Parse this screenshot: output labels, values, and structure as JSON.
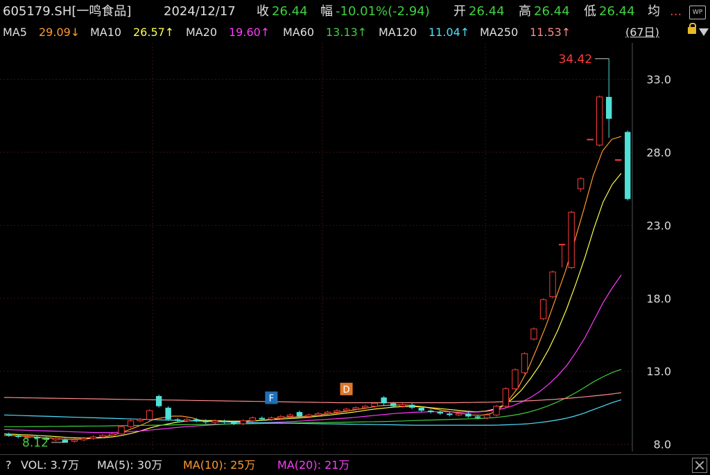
{
  "header": {
    "code": "605179.SH[一鸣食品]",
    "date": "2024/12/17",
    "close_label": "收",
    "close_value": "26.44",
    "change_label": "幅",
    "change_value": "-10.01%(-2.94)",
    "open_label": "开",
    "open_value": "26.44",
    "high_label": "高",
    "high_value": "26.44",
    "low_label": "低",
    "low_value": "26.44",
    "avg_label": "均",
    "more": "...",
    "wp_icon_text": "WP"
  },
  "ma_line": {
    "ma5": {
      "label": "MA5",
      "value": "29.09↓",
      "color": "#ff9a2e"
    },
    "ma10": {
      "label": "MA10",
      "value": "26.57↑",
      "color": "#ffff4a"
    },
    "ma20": {
      "label": "MA20",
      "value": "19.60↑",
      "color": "#ff3bff"
    },
    "ma60": {
      "label": "MA60",
      "value": "13.13↑",
      "color": "#3fcf3f"
    },
    "ma120": {
      "label": "MA120",
      "value": "11.04↑",
      "color": "#4fe0ff"
    },
    "ma250": {
      "label": "MA250",
      "value": "11.53↑",
      "color": "#ff8a8a"
    },
    "period": "(67日)"
  },
  "chart_data": {
    "type": "candlestick",
    "ylim": [
      7.5,
      35.5
    ],
    "y_ticks": [
      "33.0",
      "28.0",
      "23.0",
      "18.0",
      "13.0",
      "8.0"
    ],
    "y_tick_values": [
      33,
      28,
      23,
      18,
      13,
      8
    ],
    "annotations": {
      "max_label": "34.42",
      "max_value": 34.42,
      "min_label": "8.12",
      "min_value": 8.12,
      "flag_f": "F",
      "flag_d": "D"
    },
    "candles": [
      [
        8.7,
        8.6,
        8.8,
        8.5
      ],
      [
        8.6,
        8.5,
        8.7,
        8.4
      ],
      [
        8.5,
        8.5,
        8.6,
        8.4
      ],
      [
        8.5,
        8.4,
        8.6,
        8.3
      ],
      [
        8.4,
        8.3,
        8.5,
        8.2
      ],
      [
        8.3,
        8.4,
        8.5,
        8.2
      ],
      [
        8.3,
        8.1,
        8.4,
        8.12
      ],
      [
        8.2,
        8.3,
        8.4,
        8.1
      ],
      [
        8.3,
        8.4,
        8.5,
        8.2
      ],
      [
        8.4,
        8.5,
        8.6,
        8.3
      ],
      [
        8.5,
        8.6,
        8.7,
        8.4
      ],
      [
        8.6,
        8.7,
        8.8,
        8.5
      ],
      [
        8.7,
        9.2,
        9.3,
        8.6
      ],
      [
        9.2,
        9.6,
        9.7,
        9.1
      ],
      [
        9.6,
        9.7,
        9.8,
        9.5
      ],
      [
        9.7,
        10.3,
        10.4,
        9.6
      ],
      [
        11.3,
        10.6,
        11.4,
        10.5
      ],
      [
        10.5,
        9.7,
        10.6,
        9.6
      ],
      [
        9.7,
        9.6,
        9.8,
        9.5
      ],
      [
        9.6,
        9.7,
        9.8,
        9.5
      ],
      [
        9.7,
        9.6,
        9.8,
        9.5
      ],
      [
        9.6,
        9.5,
        9.7,
        9.4
      ],
      [
        9.5,
        9.6,
        9.7,
        9.4
      ],
      [
        9.6,
        9.5,
        9.7,
        9.4
      ],
      [
        9.5,
        9.4,
        9.6,
        9.3
      ],
      [
        9.4,
        9.6,
        9.7,
        9.3
      ],
      [
        9.6,
        9.8,
        9.9,
        9.5
      ],
      [
        9.8,
        9.7,
        9.9,
        9.6
      ],
      [
        9.7,
        9.8,
        9.9,
        9.6
      ],
      [
        9.8,
        9.9,
        10.0,
        9.7
      ],
      [
        9.9,
        10.0,
        10.1,
        9.8
      ],
      [
        10.2,
        9.9,
        10.3,
        9.8
      ],
      [
        9.9,
        10.0,
        10.1,
        9.8
      ],
      [
        10.0,
        10.1,
        10.2,
        9.9
      ],
      [
        10.1,
        10.2,
        10.3,
        10.0
      ],
      [
        10.2,
        10.3,
        10.4,
        10.1
      ],
      [
        10.3,
        10.4,
        10.5,
        10.2
      ],
      [
        10.4,
        10.5,
        10.6,
        10.3
      ],
      [
        10.5,
        10.6,
        10.7,
        10.4
      ],
      [
        10.6,
        10.8,
        10.9,
        10.5
      ],
      [
        11.2,
        10.8,
        11.3,
        10.6
      ],
      [
        10.8,
        10.6,
        10.9,
        10.5
      ],
      [
        10.6,
        10.7,
        10.8,
        10.5
      ],
      [
        10.7,
        10.5,
        10.8,
        10.4
      ],
      [
        10.5,
        10.3,
        10.6,
        10.2
      ],
      [
        10.3,
        10.2,
        10.4,
        10.1
      ],
      [
        10.2,
        10.1,
        10.3,
        10.0
      ],
      [
        10.1,
        10.0,
        10.2,
        9.9
      ],
      [
        10.0,
        10.1,
        10.2,
        9.9
      ],
      [
        10.1,
        9.9,
        10.2,
        9.8
      ],
      [
        9.9,
        9.8,
        10.0,
        9.7
      ],
      [
        9.8,
        10.0,
        10.1,
        9.7
      ],
      [
        10.0,
        10.6,
        10.7,
        9.9
      ],
      [
        10.6,
        11.8,
        11.9,
        10.5
      ],
      [
        11.8,
        13.1,
        13.2,
        11.7
      ],
      [
        12.9,
        14.2,
        14.3,
        12.8
      ],
      [
        15.2,
        15.9,
        16.0,
        15.1
      ],
      [
        16.6,
        17.9,
        18.0,
        16.5
      ],
      [
        18.1,
        19.8,
        19.9,
        18.0
      ],
      [
        21.7,
        21.7,
        21.7,
        20.1
      ],
      [
        20.1,
        23.9,
        24.0,
        20.0
      ],
      [
        25.5,
        26.2,
        26.3,
        25.3
      ],
      [
        28.9,
        28.9,
        28.9,
        28.9
      ],
      [
        28.5,
        31.8,
        31.9,
        28.4
      ],
      [
        31.8,
        30.3,
        34.42,
        29.0
      ],
      [
        27.5,
        27.5,
        27.5,
        27.5
      ],
      [
        29.4,
        24.8,
        29.5,
        24.7
      ]
    ],
    "ma_lines": {
      "ma5": [
        8.6,
        8.58,
        8.55,
        8.5,
        8.45,
        8.42,
        8.36,
        8.34,
        8.34,
        8.38,
        8.46,
        8.54,
        8.68,
        8.9,
        9.14,
        9.4,
        9.7,
        9.82,
        9.92,
        9.92,
        9.82,
        9.64,
        9.6,
        9.6,
        9.56,
        9.54,
        9.56,
        9.6,
        9.66,
        9.76,
        9.84,
        9.86,
        9.9,
        9.96,
        10.04,
        10.1,
        10.2,
        10.3,
        10.4,
        10.5,
        10.62,
        10.66,
        10.68,
        10.68,
        10.62,
        10.54,
        10.42,
        10.3,
        10.2,
        10.1,
        10.0,
        9.98,
        10.08,
        10.44,
        11.06,
        11.9,
        13.1,
        14.6,
        16.2,
        18.0,
        19.8,
        21.9,
        24.1,
        26.4,
        28.1,
        28.9,
        29.09
      ],
      "ma10": [
        8.7,
        8.68,
        8.65,
        8.62,
        8.58,
        8.55,
        8.5,
        8.46,
        8.43,
        8.42,
        8.42,
        8.44,
        8.5,
        8.6,
        8.74,
        8.9,
        9.1,
        9.26,
        9.38,
        9.5,
        9.58,
        9.62,
        9.62,
        9.62,
        9.6,
        9.58,
        9.58,
        9.6,
        9.62,
        9.66,
        9.7,
        9.74,
        9.78,
        9.82,
        9.88,
        9.94,
        10.0,
        10.08,
        10.16,
        10.24,
        10.34,
        10.42,
        10.48,
        10.54,
        10.58,
        10.58,
        10.56,
        10.5,
        10.44,
        10.38,
        10.32,
        10.26,
        10.22,
        10.26,
        10.4,
        10.66,
        11.1,
        11.7,
        12.5,
        13.4,
        14.5,
        15.8,
        17.3,
        19.0,
        20.8,
        22.8,
        24.6,
        25.8,
        26.57
      ],
      "ma20": [
        9.0,
        8.98,
        8.96,
        8.94,
        8.92,
        8.9,
        8.88,
        8.86,
        8.84,
        8.82,
        8.8,
        8.8,
        8.8,
        8.82,
        8.86,
        8.9,
        8.96,
        9.02,
        9.08,
        9.14,
        9.2,
        9.24,
        9.28,
        9.32,
        9.36,
        9.4,
        9.42,
        9.44,
        9.46,
        9.48,
        9.5,
        9.52,
        9.56,
        9.6,
        9.64,
        9.68,
        9.72,
        9.76,
        9.8,
        9.86,
        9.92,
        9.98,
        10.04,
        10.1,
        10.14,
        10.18,
        10.2,
        10.22,
        10.22,
        10.22,
        10.2,
        10.2,
        10.2,
        10.24,
        10.32,
        10.44,
        10.62,
        10.88,
        11.2,
        11.6,
        12.1,
        12.7,
        13.4,
        14.3,
        15.3,
        16.5,
        17.7,
        18.7,
        19.6
      ],
      "ma60": [
        9.2,
        9.2,
        9.2,
        9.21,
        9.21,
        9.22,
        9.22,
        9.23,
        9.23,
        9.24,
        9.24,
        9.25,
        9.26,
        9.27,
        9.28,
        9.29,
        9.3,
        9.31,
        9.32,
        9.33,
        9.34,
        9.35,
        9.36,
        9.37,
        9.38,
        9.39,
        9.4,
        9.41,
        9.42,
        9.43,
        9.44,
        9.45,
        9.46,
        9.47,
        9.48,
        9.49,
        9.5,
        9.51,
        9.52,
        9.53,
        9.54,
        9.56,
        9.58,
        9.6,
        9.62,
        9.64,
        9.66,
        9.68,
        9.7,
        9.72,
        9.74,
        9.76,
        9.8,
        9.86,
        9.94,
        10.04,
        10.18,
        10.36,
        10.58,
        10.84,
        11.14,
        11.48,
        11.86,
        12.26,
        12.6,
        12.9,
        13.13
      ],
      "ma120": [
        10.0,
        9.98,
        9.96,
        9.94,
        9.92,
        9.9,
        9.88,
        9.86,
        9.84,
        9.82,
        9.8,
        9.78,
        9.76,
        9.74,
        9.72,
        9.7,
        9.68,
        9.66,
        9.64,
        9.62,
        9.6,
        9.58,
        9.56,
        9.54,
        9.52,
        9.5,
        9.48,
        9.47,
        9.46,
        9.45,
        9.44,
        9.43,
        9.42,
        9.41,
        9.4,
        9.39,
        9.38,
        9.37,
        9.36,
        9.35,
        9.34,
        9.33,
        9.32,
        9.31,
        9.3,
        9.3,
        9.3,
        9.3,
        9.3,
        9.3,
        9.3,
        9.3,
        9.3,
        9.31,
        9.33,
        9.36,
        9.4,
        9.46,
        9.54,
        9.64,
        9.76,
        9.92,
        10.12,
        10.36,
        10.6,
        10.84,
        11.04
      ],
      "ma250": [
        11.2,
        11.19,
        11.18,
        11.17,
        11.16,
        11.15,
        11.14,
        11.13,
        11.12,
        11.11,
        11.1,
        11.09,
        11.08,
        11.07,
        11.06,
        11.05,
        11.04,
        11.03,
        11.02,
        11.01,
        11.0,
        10.99,
        10.98,
        10.97,
        10.96,
        10.95,
        10.94,
        10.93,
        10.92,
        10.91,
        10.9,
        10.89,
        10.88,
        10.87,
        10.86,
        10.85,
        10.84,
        10.84,
        10.84,
        10.84,
        10.84,
        10.84,
        10.84,
        10.84,
        10.84,
        10.84,
        10.84,
        10.84,
        10.84,
        10.85,
        10.86,
        10.87,
        10.88,
        10.9,
        10.92,
        10.94,
        10.97,
        11.0,
        11.04,
        11.08,
        11.13,
        11.18,
        11.24,
        11.3,
        11.37,
        11.44,
        11.53
      ]
    },
    "ma_colors": {
      "ma5": "#ff9a2e",
      "ma10": "#ffff4a",
      "ma20": "#ff3bff",
      "ma60": "#3fcf3f",
      "ma120": "#4fe0ff",
      "ma250": "#ff8a8a"
    },
    "up_color": "#ff3b3b",
    "down_color": "#4fe0d8",
    "grid": true
  },
  "volume": {
    "question": "?",
    "vol_label": "VOL: 3.7万",
    "ma5_label": "MA(5): 30万",
    "ma10_label": "MA(10): 25万",
    "ma20_label": "MA(20): 21万",
    "colors": {
      "vol": "#e0e0e0",
      "ma5": "#e0e0e0",
      "ma10": "#ff9a2e",
      "ma20": "#ff3bff"
    }
  }
}
